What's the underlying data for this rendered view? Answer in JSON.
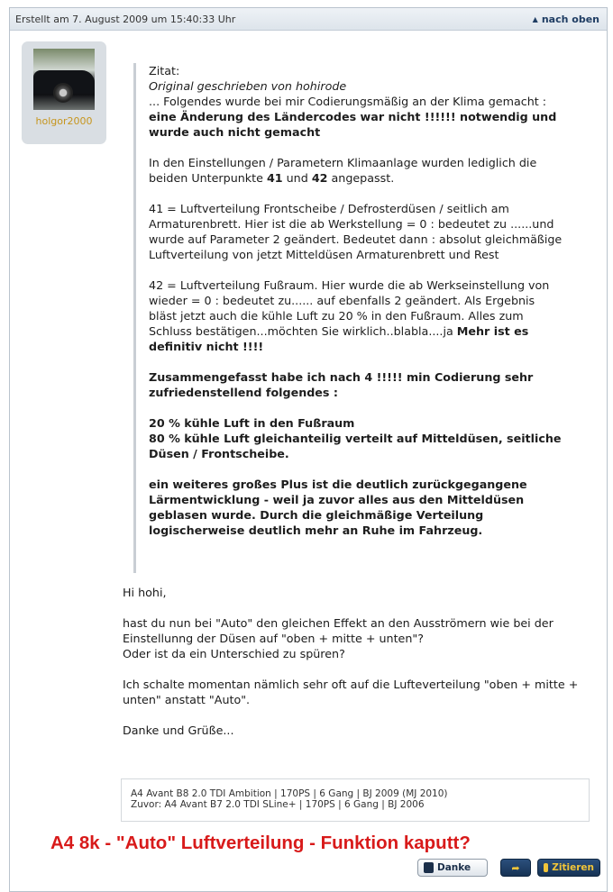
{
  "topbar": {
    "created": "Erstellt am 7. August 2009 um 15:40:33 Uhr",
    "to_top": "nach oben"
  },
  "user": {
    "name": "holgor2000"
  },
  "quote": {
    "label": "Zitat:",
    "author_line": "Original geschrieben von hohirode",
    "l1": "... Folgendes wurde bei mir Codierungsmäßig an der Klima gemacht :",
    "l2_bold": "eine Änderung des Ländercodes war nicht !!!!!! notwendig und wurde auch nicht gemacht",
    "l3a": "In den Einstellungen / Parametern Klimaanlage wurden lediglich die beiden Unterpunkte ",
    "l3_41": "41",
    "l3b": " und ",
    "l3_42": "42",
    "l3c": " angepasst.",
    "p41": "41 = Luftverteilung Frontscheibe / Defrosterdüsen / seitlich am Armaturenbrett. Hier ist die ab Werkstellung = 0 : bedeutet zu ......und wurde auf Parameter 2 geändert. Bedeutet dann : absolut gleichmäßige Luftverteilung von jetzt Mitteldüsen Armaturenbrett und Rest",
    "p42": "42 = Luftverteilung Fußraum. Hier wurde die ab Werkseinstellung von wieder = 0 : bedeutet zu...... auf ebenfalls 2 geändert. Als Ergebnis bläst jetzt auch die kühle Luft zu 20 % in den Fußraum. Alles zum Schluss bestätigen...möchten Sie wirklich..blabla....ja ",
    "p42_bold": "Mehr ist es definitiv nicht !!!!",
    "summary_bold": "Zusammengefasst habe ich nach 4 !!!!! min Codierung sehr zufriedenstellend folgendes :",
    "pct1_bold": "20 % kühle Luft in den Fußraum",
    "pct2_bold": "80 % kühle Luft gleichanteilig verteilt auf Mitteldüsen, seitliche Düsen / Frontscheibe.",
    "plus_bold": "ein weiteres großes Plus ist die deutlich zurückgegangene Lärmentwicklung - weil ja zuvor alles aus den Mitteldüsen geblasen wurde. Durch die gleichmäßige Verteilung logischerweise deutlich mehr an Ruhe im Fahrzeug."
  },
  "message": {
    "greeting": "Hi hohi,",
    "q1": "hast du nun bei \"Auto\" den gleichen Effekt an den Ausströmern wie bei der Einstellunng der Düsen auf \"oben + mitte + unten\"?",
    "q2": "Oder ist da ein Unterschied zu spüren?",
    "p2": "Ich schalte momentan nämlich sehr oft auf die Lufteverteilung \"oben + mitte + unten\" anstatt \"Auto\".",
    "closing": "Danke und Grüße..."
  },
  "signature": {
    "line1": "A4 Avant B8 2.0 TDI Ambition | 170PS | 6 Gang | BJ 2009 (MJ 2010)",
    "line2": "Zuvor: A4 Avant B7 2.0 TDI SLine+ | 170PS | 6 Gang | BJ 2006"
  },
  "headline": "A4 8k - \"Auto\" Luftverteilung - Funktion kaputt?",
  "buttons": {
    "thanks": "Danke",
    "quote": "Zitieren"
  },
  "colors": {
    "username": "#c6951d",
    "headline": "#d81a1a",
    "button_dark": "#163355"
  }
}
